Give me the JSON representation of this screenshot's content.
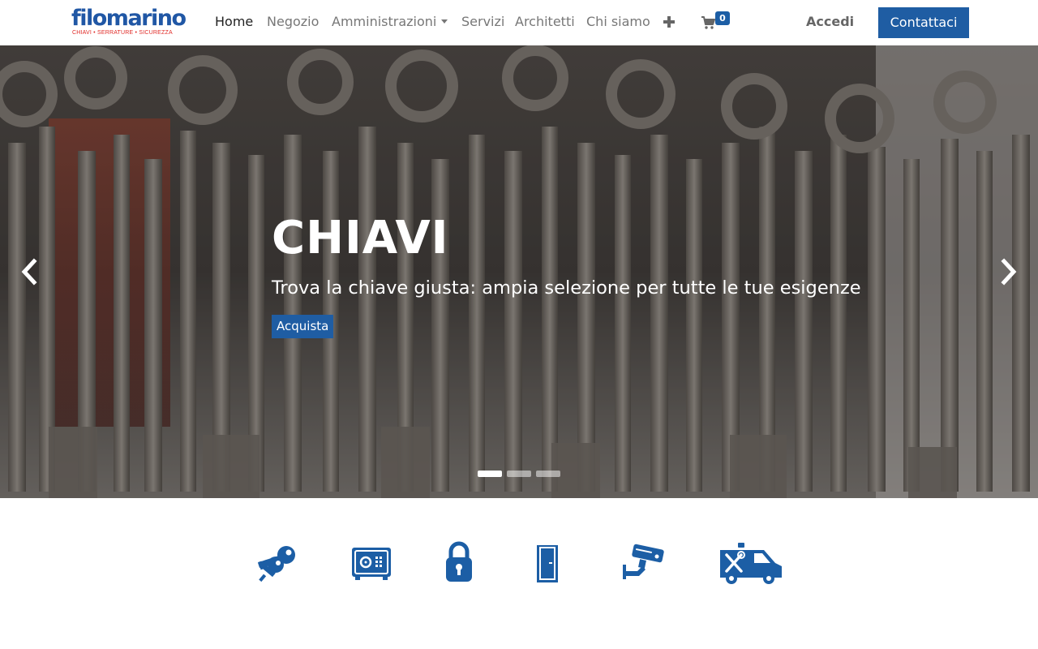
{
  "brand": {
    "name": "filomarino",
    "tagline": "CHIAVI • SERRATURE • SICUREZZA",
    "color": "#2057a5",
    "tagline_color": "#e02a26"
  },
  "nav": {
    "items": [
      {
        "label": "Home",
        "active": true
      },
      {
        "label": "Negozio"
      },
      {
        "label": "Amministrazioni",
        "dropdown": true
      },
      {
        "label": "Servizi"
      },
      {
        "label": "Architetti"
      },
      {
        "label": "Chi siamo"
      }
    ],
    "more_icon": "plus-icon",
    "cart_icon": "shopping-cart-icon",
    "cart_count": "0",
    "login_label": "Accedi",
    "contact_label": "Contattaci"
  },
  "hero": {
    "title": "CHIAVI",
    "subtitle": "Trova la chiave giusta: ampia selezione per tutte le tue esigenze",
    "button_label": "Acquista",
    "slide_count": 3,
    "active_slide": 1,
    "prev_icon": "chevron-left-icon",
    "next_icon": "chevron-right-icon"
  },
  "categories": [
    {
      "icon": "keys-icon"
    },
    {
      "icon": "safe-icon"
    },
    {
      "icon": "padlock-icon"
    },
    {
      "icon": "door-icon"
    },
    {
      "icon": "security-camera-icon"
    },
    {
      "icon": "service-van-icon"
    }
  ],
  "colors": {
    "accent": "#1f5da3",
    "icon_blue": "#1c5ea5",
    "nav_text": "#777777",
    "nav_active": "#222222"
  }
}
